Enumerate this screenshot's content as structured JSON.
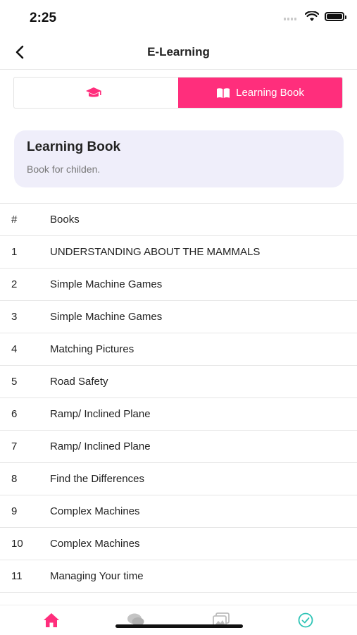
{
  "status": {
    "time": "2:25"
  },
  "nav": {
    "title": "E-Learning"
  },
  "tabs": [
    {
      "icon": "graduation-cap-icon",
      "label": ""
    },
    {
      "icon": "open-book-icon",
      "label": "Learning Book"
    }
  ],
  "card": {
    "title": "Learning Book",
    "subtitle": "Book for childen."
  },
  "table": {
    "headers": [
      "#",
      "Books"
    ],
    "rows": [
      {
        "num": "1",
        "book": "UNDERSTANDING ABOUT THE MAMMALS"
      },
      {
        "num": "2",
        "book": "Simple Machine Games"
      },
      {
        "num": "3",
        "book": "Simple Machine Games"
      },
      {
        "num": "4",
        "book": "Matching Pictures"
      },
      {
        "num": "5",
        "book": "Road Safety"
      },
      {
        "num": "6",
        "book": "Ramp/ Inclined Plane"
      },
      {
        "num": "7",
        "book": "Ramp/ Inclined Plane"
      },
      {
        "num": "8",
        "book": "Find the Differences"
      },
      {
        "num": "9",
        "book": "Complex Machines"
      },
      {
        "num": "10",
        "book": "Complex Machines"
      },
      {
        "num": "11",
        "book": "Managing Your time"
      }
    ]
  },
  "bottom_tabs": [
    "home-icon",
    "chat-icon",
    "gallery-icon",
    "check-circle-icon"
  ],
  "colors": {
    "accent": "#ff2e7c",
    "card_bg": "#efeefa",
    "teal": "#2ec4b6"
  }
}
